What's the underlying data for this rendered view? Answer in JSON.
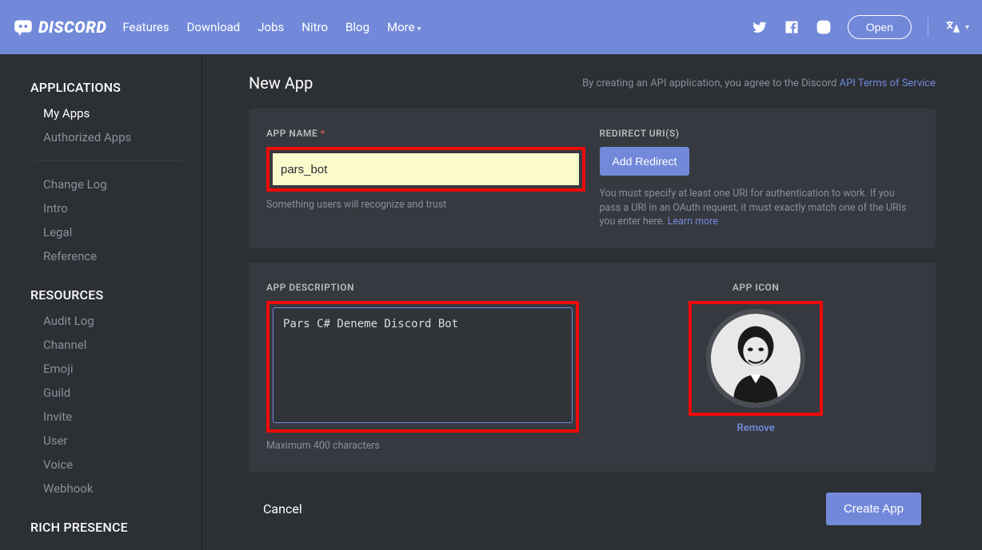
{
  "topnav": {
    "brand_text": "DISCORD",
    "links": [
      "Features",
      "Download",
      "Jobs",
      "Nitro",
      "Blog"
    ],
    "more_label": "More",
    "open_label": "Open"
  },
  "sidebar": {
    "sections": {
      "applications": {
        "title": "APPLICATIONS",
        "items": [
          "My Apps",
          "Authorized Apps"
        ]
      },
      "general": {
        "items": [
          "Change Log",
          "Intro",
          "Legal",
          "Reference"
        ]
      },
      "resources": {
        "title": "RESOURCES",
        "items": [
          "Audit Log",
          "Channel",
          "Emoji",
          "Guild",
          "Invite",
          "User",
          "Voice",
          "Webhook"
        ]
      },
      "rich_presence": {
        "title": "RICH PRESENCE"
      }
    }
  },
  "main": {
    "title": "New App",
    "terms_pre": "By creating an API application, you agree to the Discord ",
    "terms_link": "API Terms of Service",
    "app_name": {
      "label": "APP NAME",
      "value": "pars_bot",
      "help": "Something users will recognize and trust"
    },
    "redirect": {
      "label": "REDIRECT URI(S)",
      "button": "Add Redirect",
      "help_pre": "You must specify at least one URI for authentication to work. If you pass a URI in an OAuth request, it must exactly match one of the URIs you enter here. ",
      "help_link": "Learn more"
    },
    "description": {
      "label": "APP DESCRIPTION",
      "value": "Pars C# Deneme Discord Bot",
      "help": "Maximum 400 characters"
    },
    "icon": {
      "label": "APP ICON",
      "remove": "Remove"
    },
    "actions": {
      "cancel": "Cancel",
      "create": "Create App"
    }
  }
}
